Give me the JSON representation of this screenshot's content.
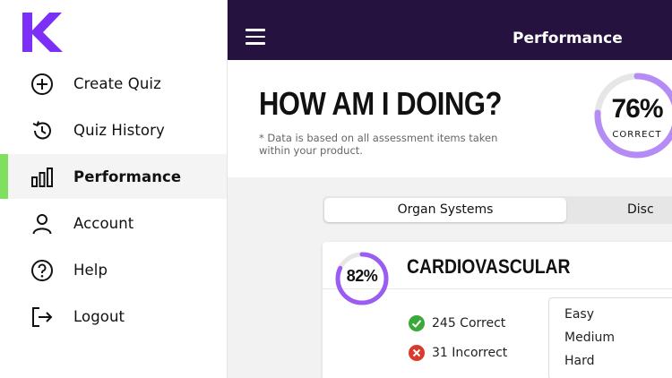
{
  "sidebar": {
    "logo_icon": "k-logo",
    "accent": "#7b2ff7",
    "active_indicator": "#7ee05e",
    "items": [
      {
        "label": "Create Quiz",
        "icon": "plus-circle-icon"
      },
      {
        "label": "Quiz History",
        "icon": "history-icon"
      },
      {
        "label": "Performance",
        "icon": "bar-chart-icon",
        "active": true
      },
      {
        "label": "Account",
        "icon": "user-icon"
      },
      {
        "label": "Help",
        "icon": "help-icon"
      },
      {
        "label": "Logout",
        "icon": "logout-icon"
      }
    ]
  },
  "header": {
    "title": "Performance",
    "menu_icon": "hamburger-icon",
    "bg": "#26123f"
  },
  "summary": {
    "headline": "HOW AM I DOING?",
    "note": "* Data is based on all assessment items taken within your product.",
    "percent": 76,
    "percent_label": "76%",
    "percent_caption": "CORRECT"
  },
  "tabs": [
    {
      "label": "Organ Systems",
      "active": true
    },
    {
      "label": "Disc"
    }
  ],
  "card": {
    "title": "CARDIOVASCULAR",
    "percent": 82,
    "percent_label": "82%",
    "correct": "245 Correct",
    "incorrect": "31 Incorrect",
    "difficulty_options": [
      "Easy",
      "Medium",
      "Hard"
    ]
  }
}
